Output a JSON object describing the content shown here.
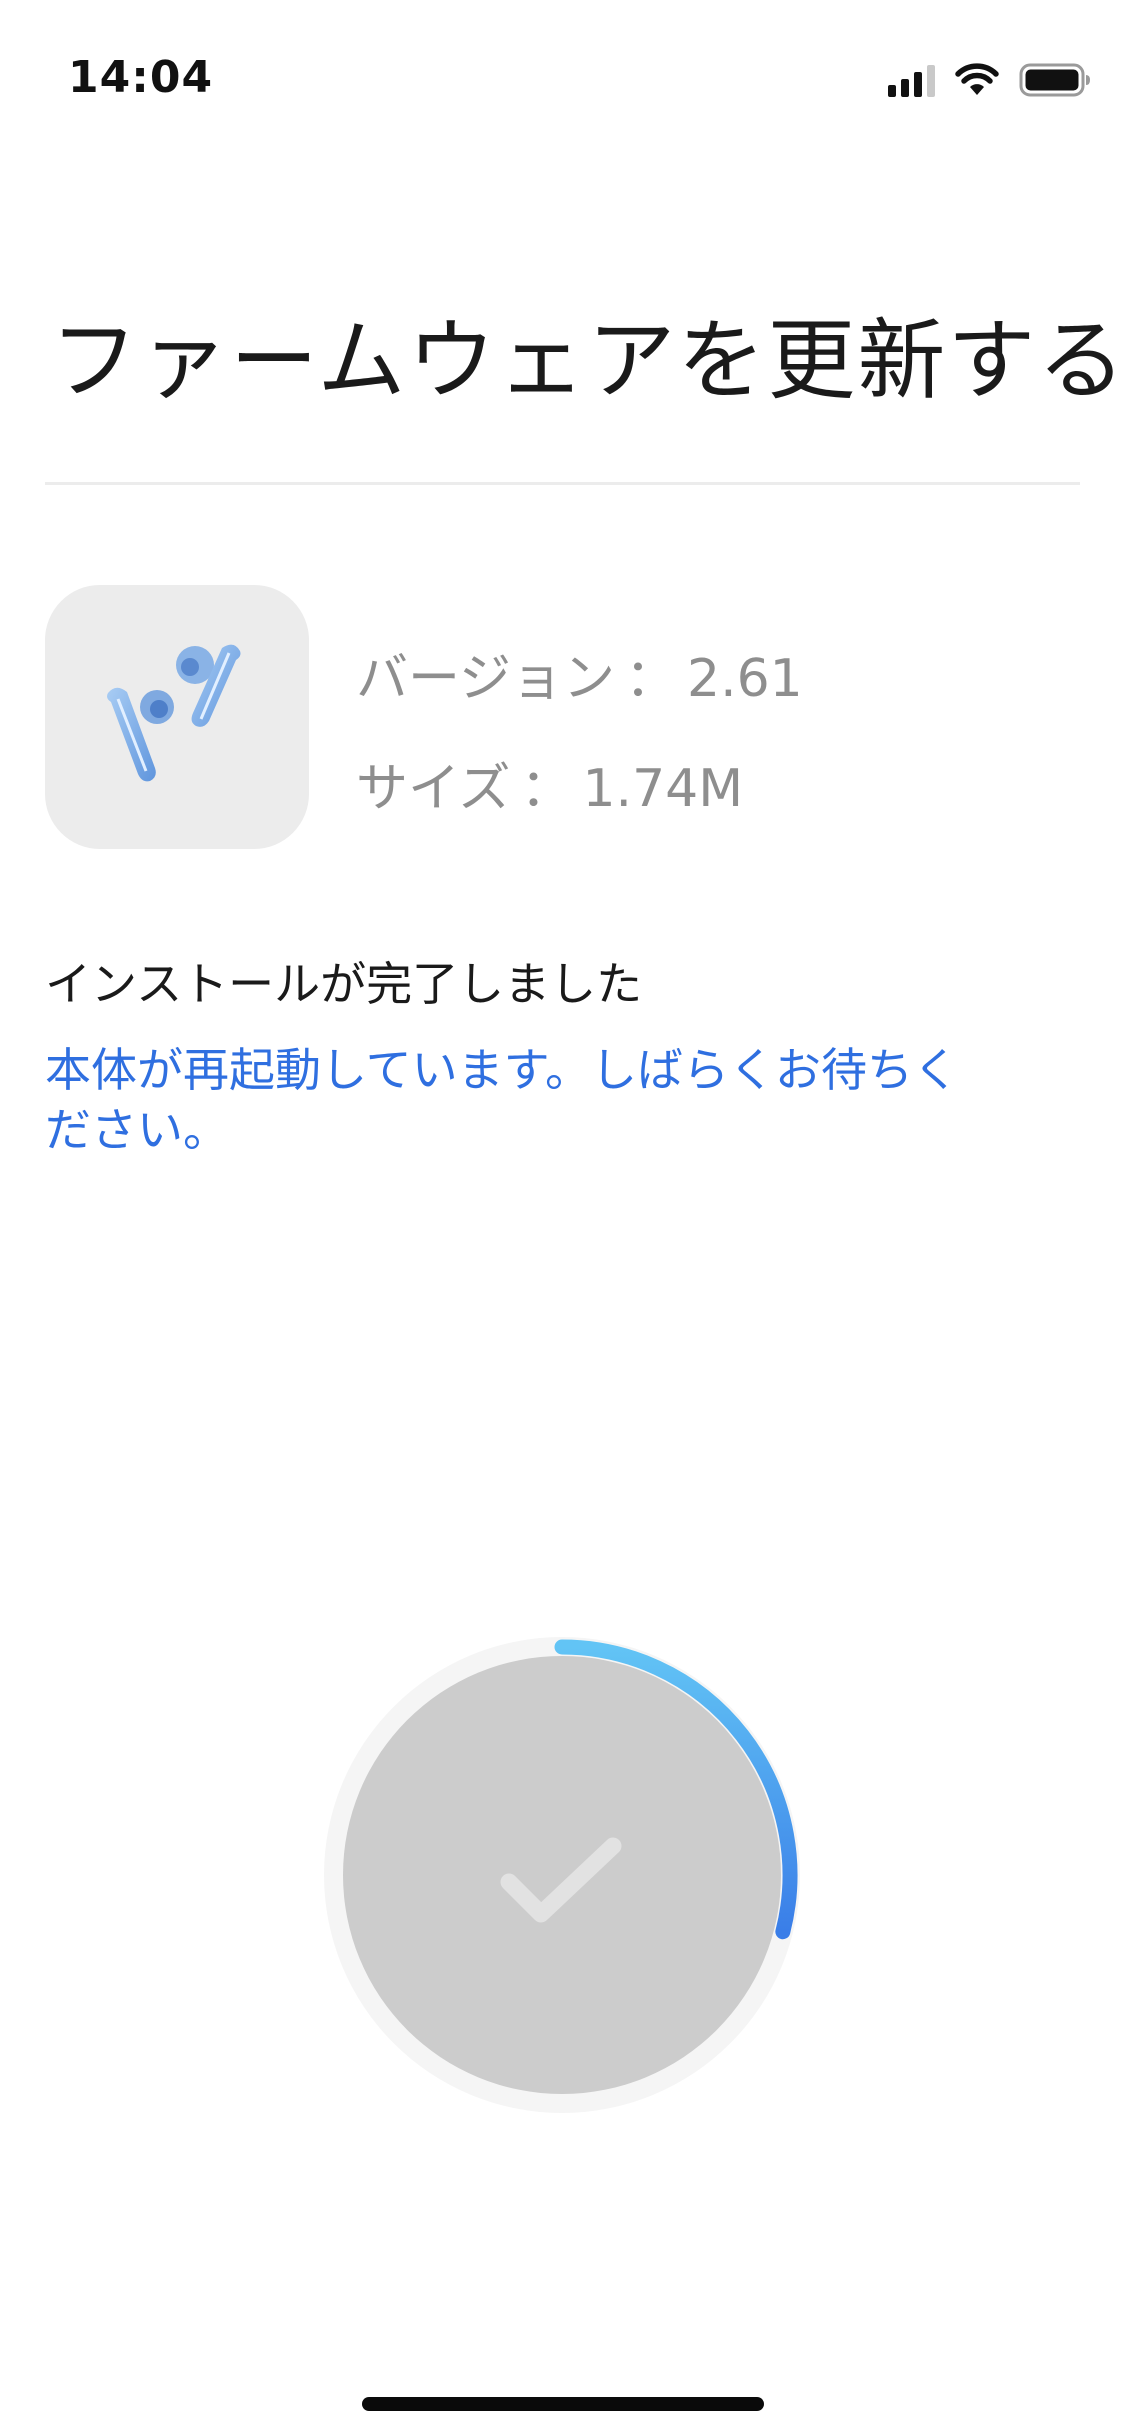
{
  "status_bar": {
    "time": "14:04",
    "icons": [
      "cellular-signal-icon",
      "wifi-icon",
      "battery-icon"
    ]
  },
  "title": "ファームウェアを更新する",
  "firmware": {
    "image_icon": "earbuds-icon",
    "version_label": "バージョン",
    "version_value": "2.61",
    "size_label": "サイズ",
    "size_value": "1.74M"
  },
  "install_status": "インストールが完了しました",
  "restart_message": "本体が再起動しています。しばらくお待ちください。",
  "progress": {
    "fraction": 0.29,
    "icon": "checkmark-icon",
    "colors": {
      "track": "#f5f5f5",
      "fill_start": "#62c4f5",
      "fill_end": "#3a7ee8",
      "inner": "#cccccc",
      "check": "#e2e2e2"
    }
  },
  "colors": {
    "accent": "#2f6fe0",
    "secondary_text": "#8e8e8e",
    "thumb_bg": "#ececec"
  }
}
